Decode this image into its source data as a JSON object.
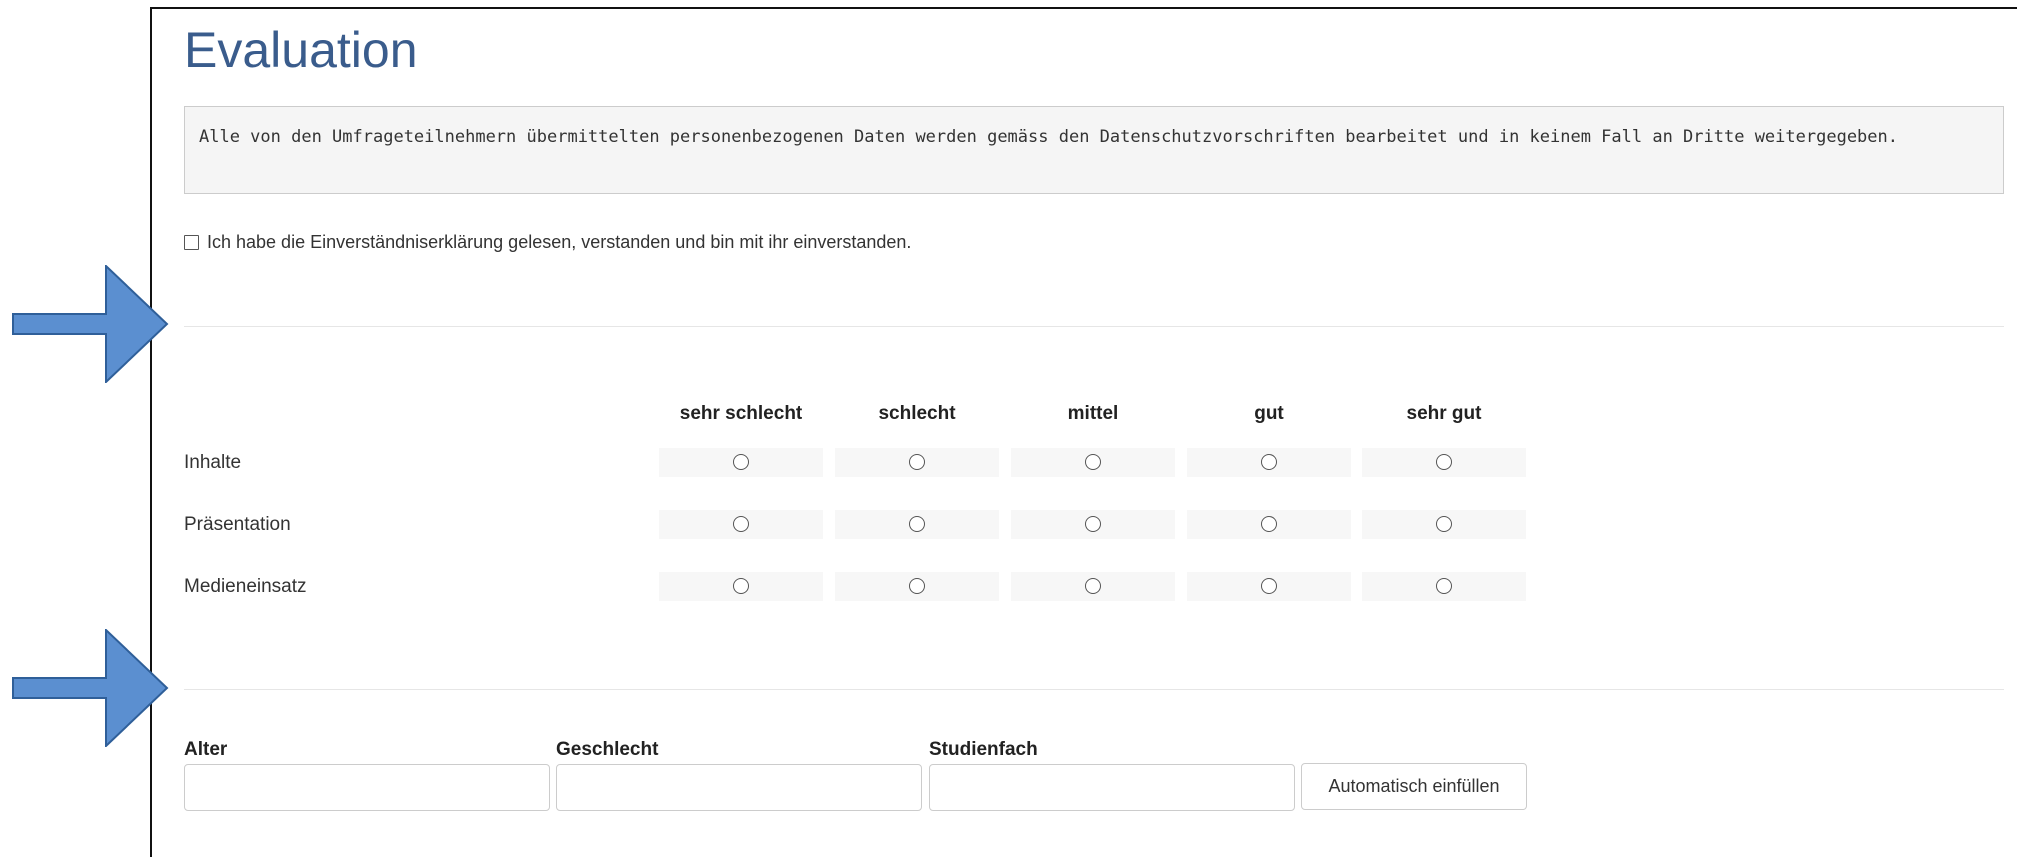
{
  "page": {
    "title": "Evaluation",
    "notice": "Alle von den Umfrageteilnehmern übermittelten personenbezogenen Daten werden gemäss den Datenschutzvorschriften bearbeitet und in keinem Fall an Dritte weitergegeben.",
    "consent_label": "Ich habe die Einverständniserklärung gelesen, verstanden und bin mit ihr einverstanden.",
    "consent_checked": false
  },
  "rating": {
    "columns": [
      "sehr schlecht",
      "schlecht",
      "mittel",
      "gut",
      "sehr gut"
    ],
    "rows": [
      "Inhalte",
      "Präsentation",
      "Medieneinsatz"
    ]
  },
  "fields": {
    "alter_label": "Alter",
    "alter_value": "",
    "geschlecht_label": "Geschlecht",
    "geschlecht_value": "",
    "studienfach_label": "Studienfach",
    "studienfach_value": "",
    "autofill_button": "Automatisch einfüllen"
  },
  "annotations": {
    "arrow_color": "#5b8fd0",
    "arrow_border": "#2f5f99",
    "arrow_icon": "right-arrow-icon"
  }
}
